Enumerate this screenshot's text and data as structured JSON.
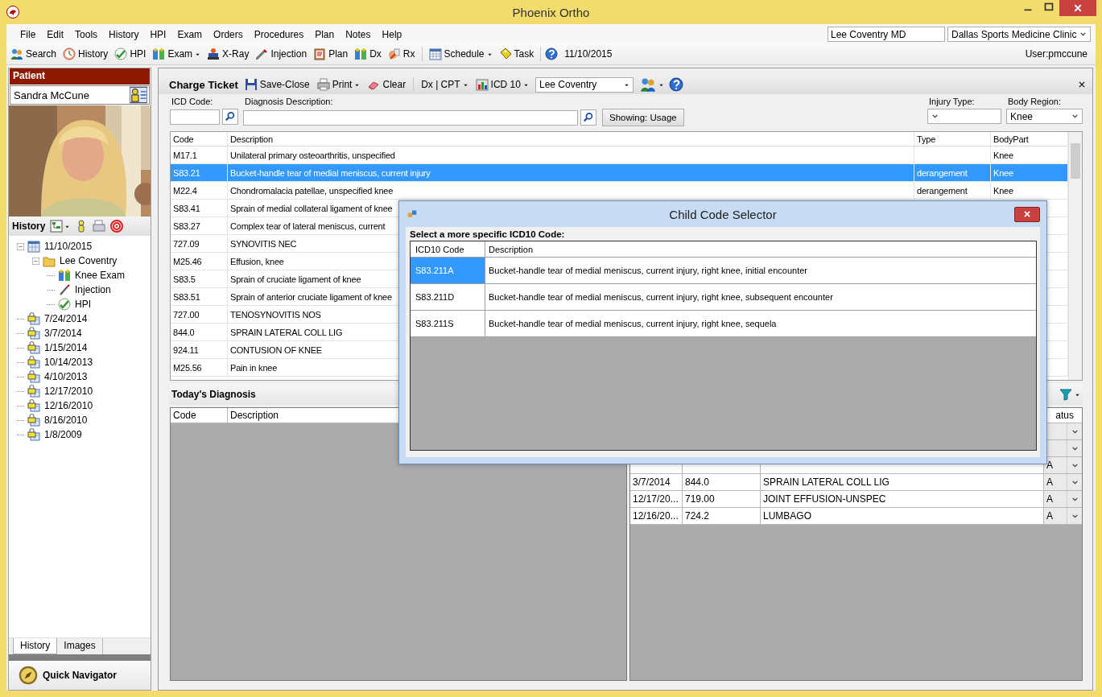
{
  "window": {
    "title": "Phoenix Ortho"
  },
  "menu": [
    "File",
    "Edit",
    "Tools",
    "History",
    "HPI",
    "Exam",
    "Orders",
    "Procedures",
    "Plan",
    "Notes",
    "Help"
  ],
  "provider_field": {
    "value": "Lee Coventry MD"
  },
  "clinic_select": {
    "value": "Dallas Sports Medicine Clinic"
  },
  "toolbar": [
    {
      "label": "Search",
      "dropdown": false
    },
    {
      "label": "History",
      "dropdown": false
    },
    {
      "label": "HPI",
      "dropdown": false
    },
    {
      "label": "Exam",
      "dropdown": true
    },
    {
      "label": "X-Ray",
      "dropdown": false
    },
    {
      "label": "Injection",
      "dropdown": false
    },
    {
      "label": "Plan",
      "dropdown": false
    },
    {
      "label": "Dx",
      "dropdown": false
    },
    {
      "label": "Rx",
      "dropdown": false
    },
    {
      "label": "Schedule",
      "dropdown": true
    },
    {
      "label": "Task",
      "dropdown": false
    }
  ],
  "toolbar_date": "11/10/2015",
  "user": "User:pmccune",
  "patient_panel": {
    "header": "Patient",
    "name": "Sandra McCune"
  },
  "history_panel": {
    "title": "History",
    "tree": [
      {
        "label": "11/10/2015",
        "kind": "visit",
        "expanded": true,
        "children": [
          {
            "label": "Lee Coventry",
            "kind": "folder",
            "expanded": true,
            "children": [
              {
                "label": "Knee Exam",
                "kind": "exam"
              },
              {
                "label": "Injection",
                "kind": "injection"
              },
              {
                "label": "HPI",
                "kind": "hpi"
              }
            ]
          }
        ]
      },
      {
        "label": "7/24/2014",
        "kind": "locked"
      },
      {
        "label": "3/7/2014",
        "kind": "locked"
      },
      {
        "label": "1/15/2014",
        "kind": "locked"
      },
      {
        "label": "10/14/2013",
        "kind": "locked"
      },
      {
        "label": "4/10/2013",
        "kind": "locked"
      },
      {
        "label": "12/17/2010",
        "kind": "locked"
      },
      {
        "label": "12/16/2010",
        "kind": "locked"
      },
      {
        "label": "8/16/2010",
        "kind": "locked"
      },
      {
        "label": "1/8/2009",
        "kind": "locked"
      }
    ]
  },
  "left_tabs": [
    {
      "label": "History",
      "selected": true
    },
    {
      "label": "Images",
      "selected": false
    }
  ],
  "quick_navigator": "Quick Navigator",
  "charge_ticket": {
    "title": "Charge Ticket",
    "save_close": "Save-Close",
    "print": "Print",
    "clear": "Clear",
    "dx_cpt": "Dx | CPT",
    "icd": "ICD 10",
    "provider": "Lee Coventry"
  },
  "search": {
    "icd_code_label": "ICD Code:",
    "diagnosis_label": "Diagnosis Description:",
    "showing_button": "Showing: Usage",
    "injury_type_label": "Injury Type:",
    "body_region_label": "Body Region:",
    "body_region_value": "Knee"
  },
  "icd_table": {
    "columns": [
      "Code",
      "Description",
      "Type",
      "BodyPart"
    ],
    "rows": [
      {
        "code": "M17.1",
        "description": "Unilateral primary osteoarthritis, unspecified",
        "body_part": "Knee",
        "selected": false
      },
      {
        "code": "S83.21",
        "description": "Bucket-handle tear of medial meniscus, current injury",
        "type": "derangement",
        "body_part": "Knee",
        "selected": true
      },
      {
        "code": "M22.4",
        "description": "Chondromalacia patellae, unspecified knee",
        "type": "derangement",
        "body_part": "Knee",
        "selected": false
      },
      {
        "code": "S83.41",
        "description": "Sprain of medial collateral ligament of knee",
        "selected": false
      },
      {
        "code": "S83.27",
        "description": "Complex tear of lateral meniscus, current",
        "selected": false
      },
      {
        "code": "727.09",
        "description": "SYNOVITIS NEC",
        "selected": false
      },
      {
        "code": "M25.46",
        "description": "Effusion, knee",
        "selected": false
      },
      {
        "code": "S83.5",
        "description": "Sprain of cruciate ligament of knee",
        "selected": false
      },
      {
        "code": "S83.51",
        "description": "Sprain of anterior cruciate ligament of knee",
        "selected": false
      },
      {
        "code": "727.00",
        "description": "TENOSYNOVITIS NOS",
        "selected": false
      },
      {
        "code": "844.0",
        "description": "SPRAIN LATERAL COLL LIG",
        "selected": false
      },
      {
        "code": "924.11",
        "description": "CONTUSION OF KNEE",
        "selected": false
      },
      {
        "code": "M25.56",
        "description": "Pain in knee",
        "selected": false
      }
    ]
  },
  "todays_diagnosis": {
    "title": "Today's Diagnosis",
    "columns": [
      "Code",
      "Description"
    ]
  },
  "history_table": {
    "status_header": "atus",
    "rows": [
      {
        "kind": "covered"
      },
      {
        "kind": "covered"
      },
      {
        "kind": "covered",
        "status": "A"
      },
      {
        "kind": "entry",
        "date": "3/7/2014",
        "code": "844.0",
        "description": "SPRAIN LATERAL COLL LIG",
        "status": "A"
      },
      {
        "kind": "entry",
        "date": "12/17/20...",
        "code": "719.00",
        "description": "JOINT EFFUSION-UNSPEC",
        "status": "A"
      },
      {
        "kind": "entry",
        "date": "12/16/20...",
        "code": "724.2",
        "description": "LUMBAGO",
        "status": "A"
      }
    ]
  },
  "dialog": {
    "title": "Child Code Selector",
    "prompt": "Select a more specific ICD10 Code:",
    "columns": [
      "ICD10 Code",
      "Description"
    ],
    "rows": [
      {
        "code": "S83.211A",
        "description": "Bucket-handle tear of medial meniscus, current injury, right knee, initial encounter",
        "selected": true
      },
      {
        "code": "S83.211D",
        "description": "Bucket-handle tear of medial meniscus, current injury, right knee, subsequent encounter",
        "selected": false
      },
      {
        "code": "S83.211S",
        "description": "Bucket-handle tear of medial meniscus, current injury, right knee, sequela",
        "selected": false
      }
    ]
  }
}
